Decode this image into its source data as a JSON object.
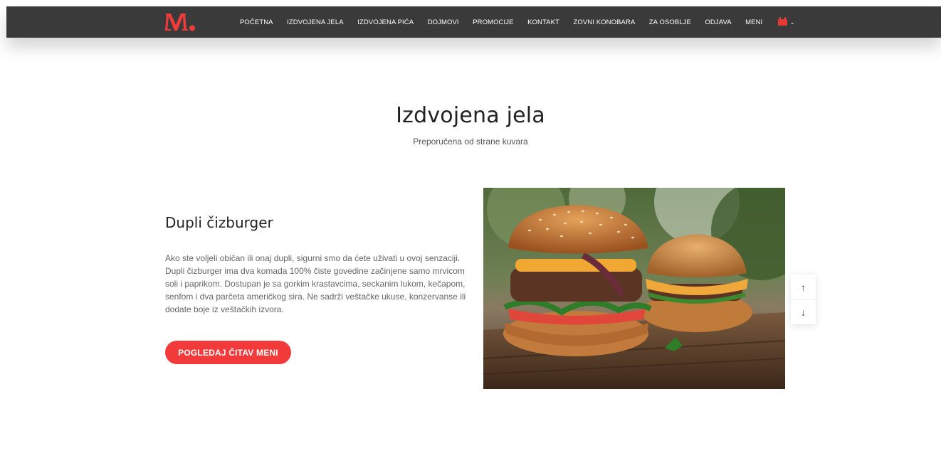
{
  "header": {
    "logo_text": "M.",
    "nav_items": [
      {
        "label": "POČETNA"
      },
      {
        "label": "IZDVOJENA JELA"
      },
      {
        "label": "IZDVOJENA PIĆA"
      },
      {
        "label": "DOJMOVI"
      },
      {
        "label": "PROMOCIJE"
      },
      {
        "label": "KONTAKT"
      },
      {
        "label": "ZOVNI KONOBARA"
      },
      {
        "label": "ZA OSOBLJE"
      },
      {
        "label": "ODJAVA"
      },
      {
        "label": "MENI"
      }
    ],
    "language_icon": "flag-icon",
    "language_chevron": "⌄"
  },
  "section": {
    "title": "Izdvojena jela",
    "subtitle": "Preporučena od strane kuvara"
  },
  "dish": {
    "name": "Dupli čizburger",
    "description": "Ako ste voljeli običan ili onaj dupli, sigurni smo da ćete uživati u ovoj senzaciji. Dupli čizburger ima dva komada 100% čiste govedine začinjene samo mrvicom soli i paprikom. Dostupan je sa gorkim krastavcima, seckanim lukom, kečapom, senfom i dva parčeta američkog sira. Ne sadrži veštačke ukuse, konzervanse ili dodate boje iz veštačkih izvora.",
    "button_label": "POGLEDAJ ČITAV MENI"
  },
  "slider": {
    "up_symbol": "↑",
    "down_symbol": "↓"
  },
  "colors": {
    "accent": "#f23a3a",
    "navbar": "#3a3a3a"
  }
}
